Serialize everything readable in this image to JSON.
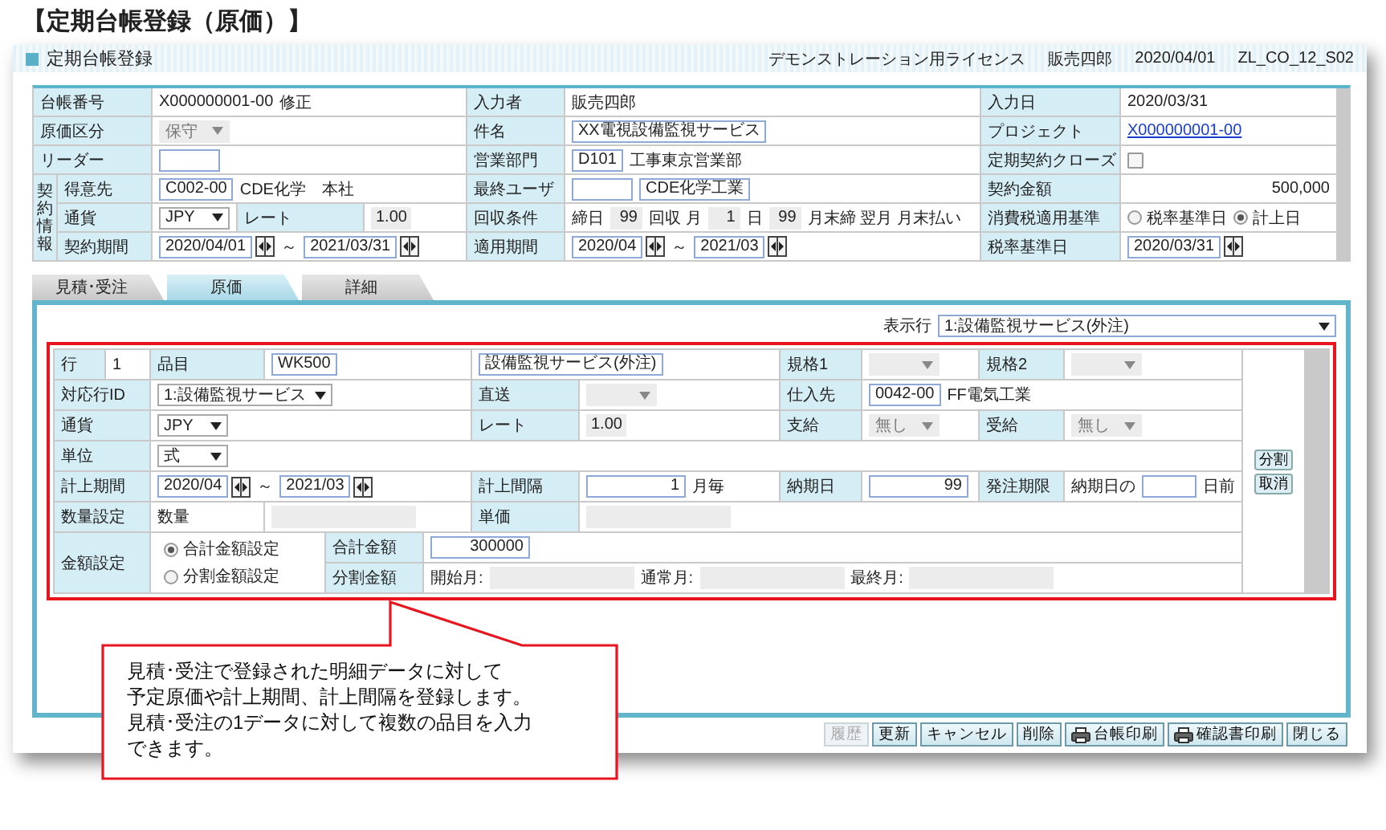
{
  "page_title": "【定期台帳登録（原価）】",
  "window": {
    "title": "定期台帳登録",
    "license": "デモンストレーション用ライセンス",
    "user": "販売四郎",
    "date": "2020/04/01",
    "screen_id": "ZL_CO_12_S02"
  },
  "header": {
    "group_label": "契約情報",
    "rows": [
      {
        "cells": [
          {
            "label": "台帳番号"
          },
          {
            "parts": [
              {
                "kind": "text",
                "text": "X000000001-00"
              },
              {
                "kind": "text",
                "text": "修正"
              }
            ]
          },
          {
            "label": "入力者"
          },
          {
            "parts": [
              {
                "kind": "text",
                "text": "販売四郎"
              }
            ]
          },
          {
            "label": "入力日"
          },
          {
            "parts": [
              {
                "kind": "text",
                "text": "2020/03/31"
              }
            ]
          }
        ]
      },
      {
        "cells": [
          {
            "label": "原価区分"
          },
          {
            "parts": [
              {
                "kind": "select",
                "value": "保守",
                "disabled": true
              }
            ]
          },
          {
            "label": "件名"
          },
          {
            "parts": [
              {
                "kind": "input",
                "value": "XX電視設備監視サービス"
              }
            ]
          },
          {
            "label": "プロジェクト"
          },
          {
            "parts": [
              {
                "kind": "link",
                "text": "X000000001-00"
              }
            ]
          }
        ]
      },
      {
        "cells": [
          {
            "label": "リーダー"
          },
          {
            "parts": [
              {
                "kind": "input"
              }
            ]
          },
          {
            "label": "営業部門"
          },
          {
            "parts": [
              {
                "kind": "input",
                "value": "D101"
              },
              {
                "kind": "text",
                "text": "工事東京営業部"
              }
            ]
          },
          {
            "label": "定期契約クローズ"
          },
          {
            "parts": [
              {
                "kind": "checkbox",
                "checked": false
              }
            ]
          }
        ]
      },
      {
        "cells": [
          {
            "label": "得意先"
          },
          {
            "parts": [
              {
                "kind": "input",
                "value": "C002-00"
              },
              {
                "kind": "text",
                "text": "CDE化学　本社"
              }
            ]
          },
          {
            "label": "最終ユーザ"
          },
          {
            "parts": [
              {
                "kind": "input"
              },
              {
                "kind": "input",
                "value": "CDE化学工業"
              }
            ]
          },
          {
            "label": "契約金額"
          },
          {
            "parts": [
              {
                "kind": "amount",
                "text": "500,000"
              }
            ]
          }
        ]
      },
      {
        "cells": [
          {
            "label": "通貨"
          },
          {
            "parts": [
              {
                "kind": "select",
                "value": "JPY",
                "disabled": false
              },
              {
                "kind": "label",
                "text": "レート"
              },
              {
                "kind": "readonly",
                "value": "1.00"
              }
            ]
          },
          {
            "label": "回収条件"
          },
          {
            "parts": [
              {
                "kind": "text",
                "text": "締日"
              },
              {
                "kind": "readonly",
                "value": "99"
              },
              {
                "kind": "text",
                "text": "回収 月"
              },
              {
                "kind": "readonly",
                "value": "1"
              },
              {
                "kind": "text",
                "text": "日"
              },
              {
                "kind": "readonly",
                "value": "99"
              },
              {
                "kind": "text",
                "text": "月末締 翌月 月末払い"
              }
            ]
          },
          {
            "label": "消費税適用基準"
          },
          {
            "parts": [
              {
                "kind": "radio",
                "text": "税率基準日",
                "selected": false
              },
              {
                "kind": "radio",
                "text": "計上日",
                "selected": true
              }
            ]
          }
        ]
      },
      {
        "cells": [
          {
            "label": "契約期間"
          },
          {
            "parts": [
              {
                "kind": "date",
                "value": "2020/04/01"
              },
              {
                "kind": "text",
                "text": "～"
              },
              {
                "kind": "date",
                "value": "2021/03/31"
              }
            ]
          },
          {
            "label": "適用期間"
          },
          {
            "parts": [
              {
                "kind": "date",
                "value": "2020/04"
              },
              {
                "kind": "text",
                "text": "～"
              },
              {
                "kind": "date",
                "value": "2021/03"
              }
            ]
          },
          {
            "label": "税率基準日"
          },
          {
            "parts": [
              {
                "kind": "date",
                "value": "2020/03/31"
              }
            ]
          }
        ]
      }
    ]
  },
  "tabs": [
    {
      "label": "見積･受注",
      "selected": false
    },
    {
      "label": "原価",
      "selected": true
    },
    {
      "label": "詳細",
      "selected": false
    }
  ],
  "detail": {
    "display_row": {
      "label": "表示行",
      "value": "1:設備監視サービス(外注)"
    },
    "rows": [
      {
        "cells": [
          {
            "label": "行",
            "parts": [
              {
                "kind": "text",
                "text": "1"
              }
            ]
          },
          {
            "label": "品目"
          },
          {
            "parts": [
              {
                "kind": "input",
                "value": "WK500"
              }
            ]
          },
          {
            "parts": [
              {
                "kind": "input",
                "value": "設備監視サービス(外注)"
              }
            ]
          },
          {
            "label": "規格1"
          },
          {
            "parts": [
              {
                "kind": "select",
                "disabled": true
              }
            ]
          },
          {
            "label": "規格2"
          },
          {
            "parts": [
              {
                "kind": "select",
                "disabled": true
              }
            ]
          }
        ]
      },
      {
        "cells": [
          {
            "label": "対応行ID"
          },
          {
            "parts": [
              {
                "kind": "select",
                "value": "1:設備監視サービス",
                "disabled": false
              }
            ]
          },
          {
            "label": "直送"
          },
          {
            "parts": [
              {
                "kind": "select",
                "disabled": true
              }
            ]
          },
          {
            "label": "仕入先"
          },
          {
            "parts": [
              {
                "kind": "input",
                "value": "0042-00"
              },
              {
                "kind": "text",
                "text": "FF電気工業"
              }
            ]
          }
        ]
      },
      {
        "cells": [
          {
            "label": "通貨"
          },
          {
            "parts": [
              {
                "kind": "select",
                "value": "JPY",
                "disabled": false
              }
            ]
          },
          {
            "label": "レート"
          },
          {
            "parts": [
              {
                "kind": "readonly",
                "value": "1.00"
              }
            ]
          },
          {
            "label": "支給"
          },
          {
            "parts": [
              {
                "kind": "select",
                "value": "無し",
                "disabled": true
              }
            ]
          },
          {
            "label": "受給"
          },
          {
            "parts": [
              {
                "kind": "select",
                "value": "無し",
                "disabled": true
              }
            ]
          }
        ]
      },
      {
        "cells": [
          {
            "label": "単位"
          },
          {
            "parts": [
              {
                "kind": "select",
                "value": "式",
                "disabled": false
              }
            ]
          }
        ]
      },
      {
        "cells": [
          {
            "label": "計上期間"
          },
          {
            "parts": [
              {
                "kind": "date",
                "value": "2020/04"
              },
              {
                "kind": "text",
                "text": "～"
              },
              {
                "kind": "date",
                "value": "2021/03"
              }
            ]
          },
          {
            "label": "計上間隔"
          },
          {
            "parts": [
              {
                "kind": "number",
                "value": "1"
              },
              {
                "kind": "text",
                "text": "月毎"
              }
            ]
          },
          {
            "label": "納期日"
          },
          {
            "parts": [
              {
                "kind": "number",
                "value": "99"
              }
            ]
          },
          {
            "label": "発注期限"
          },
          {
            "parts": [
              {
                "kind": "text",
                "text": "納期日の"
              },
              {
                "kind": "input"
              },
              {
                "kind": "text",
                "text": "日前"
              }
            ]
          }
        ]
      },
      {
        "cells": [
          {
            "label": "数量設定"
          },
          {
            "parts": [
              {
                "kind": "text",
                "text": "数量"
              }
            ]
          },
          {
            "parts": [
              {
                "kind": "readonly"
              }
            ]
          },
          {
            "label": "単価"
          },
          {
            "parts": [
              {
                "kind": "readonly"
              }
            ]
          }
        ]
      }
    ],
    "amount": {
      "label": "金額設定",
      "options": [
        {
          "text": "合計金額設定",
          "selected": true
        },
        {
          "text": "分割金額設定",
          "selected": false
        }
      ],
      "rows": [
        {
          "label": "合計金額",
          "parts": [
            {
              "kind": "number",
              "value": "300000"
            }
          ]
        },
        {
          "label": "分割金額",
          "parts": [
            {
              "kind": "text",
              "text": "開始月:"
            },
            {
              "kind": "readonly"
            },
            {
              "kind": "text",
              "text": "通常月:"
            },
            {
              "kind": "readonly"
            },
            {
              "kind": "text",
              "text": "最終月:"
            },
            {
              "kind": "readonly"
            }
          ]
        }
      ]
    },
    "actions": [
      {
        "label": "分割"
      },
      {
        "label": "取消"
      }
    ]
  },
  "callout": [
    "見積･受注で登録された明細データに対して",
    "予定原価や計上期間、計上間隔を登録します。",
    "見積･受注の1データに対して複数の品目を入力",
    "できます。"
  ],
  "buttons": [
    {
      "label": "履歴",
      "kind": "plain",
      "disabled": true
    },
    {
      "label": "更新",
      "kind": "plain",
      "disabled": false
    },
    {
      "label": "キャンセル",
      "kind": "plain",
      "disabled": false
    },
    {
      "label": "削除",
      "kind": "plain",
      "disabled": false
    },
    {
      "label": "台帳印刷",
      "kind": "print",
      "disabled": false
    },
    {
      "label": "確認書印刷",
      "kind": "print",
      "disabled": false
    },
    {
      "label": "閉じる",
      "kind": "plain",
      "disabled": false
    }
  ]
}
